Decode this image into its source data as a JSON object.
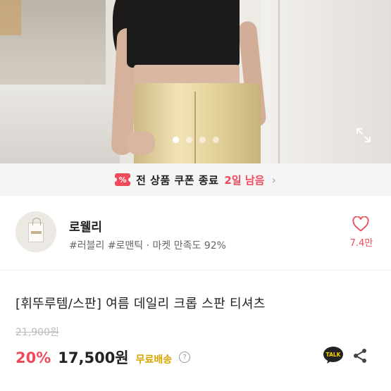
{
  "gallery": {
    "dots": 4,
    "active_index": 0,
    "expand_icon": "expand-icon"
  },
  "coupon": {
    "icon": "coupon-icon",
    "icon_glyph": "%",
    "text": "전 상품 쿠폰 종료",
    "remaining": "2일 남음",
    "chevron": "›"
  },
  "seller": {
    "name": "로웰리",
    "tags": "#러블리 #로맨틱 · 마켓 만족도 92%",
    "likes": "7.4만"
  },
  "product": {
    "title": "[휘뚜루템/스판] 여름 데일리 크롭 스판 티셔츠",
    "original_price": "21,900원",
    "discount": "20%",
    "price": "17,500원",
    "shipping": "무료배송",
    "shipping_info_glyph": "?"
  },
  "actions": {
    "talk_label": "TALK"
  },
  "colors": {
    "accent": "#ef4a5c",
    "shipping": "#d9a400",
    "talk_bg": "#222222"
  }
}
